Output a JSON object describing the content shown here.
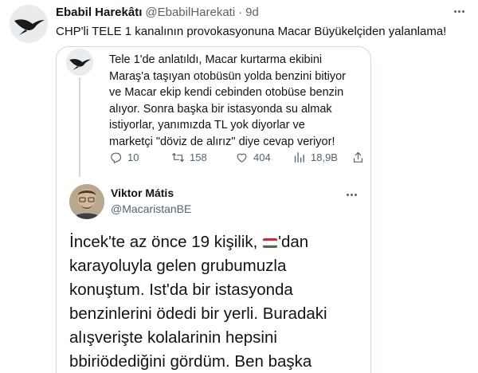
{
  "tweet": {
    "author_name": "Ebabil Harekâtı",
    "author_handle": "@EbabilHarekati",
    "separator": "·",
    "time": "9d",
    "text": "CHP'li TELE 1 kanalının provokasyonuna Macar Büyükelçiden yalanlama!",
    "more_icon": "more-horizontal-icon"
  },
  "thread_tweet": {
    "lines": [
      "Tele 1'de anlatıldı, Macar kurtarma ekibini",
      "Maraş'a taşıyan otobüsün yolda benzini bitiyor",
      "ve Macar ekip kendi cebinden otobüse benzin",
      "alıyor. Sonra başka bir istasyonda su almak",
      "istiyorlar, yanımızda TL yok diyorlar ve",
      "marketçi \"döviz de alırız\" diye cevap veriyor!"
    ],
    "actions": {
      "replies": "10",
      "retweets": "158",
      "likes": "404",
      "views": "18,9B"
    }
  },
  "quoted_tweet": {
    "author_name": "Viktor Mátis",
    "author_handle": "@MacaristanBE",
    "lines": [
      "İncek'te az önce 19 kişilik,",
      "'dan",
      "karayoluyla gelen grubumuzla",
      "konuştum. Ist'da bir istasyonda",
      "benzinlerini ödedi bir yerli. Buradaki",
      "alışverişte kolalarinin hepsini",
      "bbiriödediğini gördüm. Ben başka"
    ],
    "flag_emoji": "hungary-flag",
    "flag_colors": [
      "#ce2939",
      "#ffffff",
      "#477050"
    ]
  },
  "colors": {
    "text_primary": "#0f1419",
    "text_secondary": "#536471",
    "border": "#cfd9de"
  }
}
